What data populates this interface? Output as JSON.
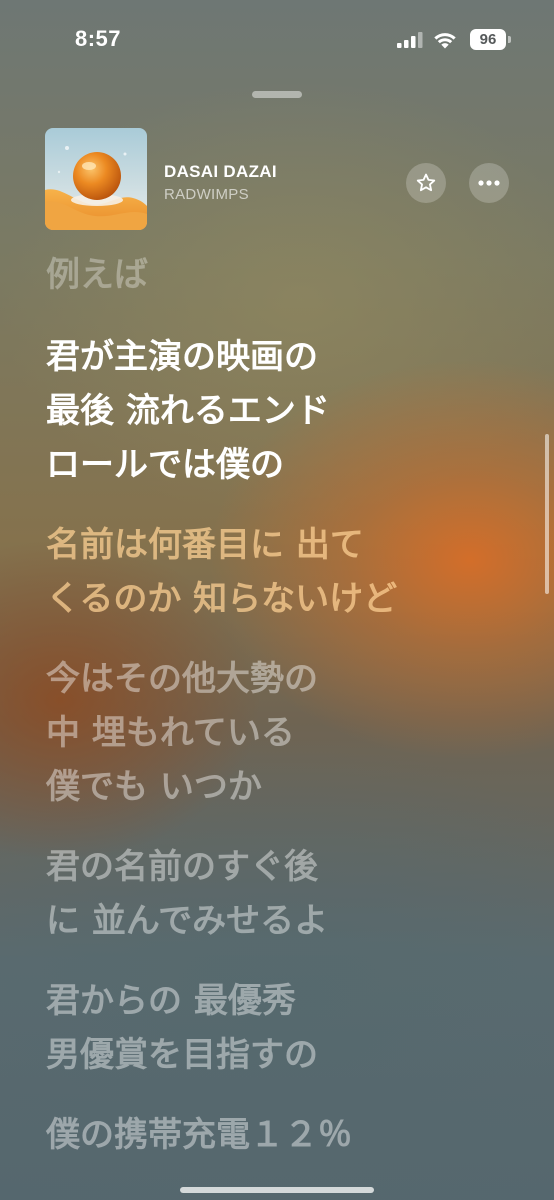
{
  "status_bar": {
    "time": "8:57",
    "battery": "96"
  },
  "now_playing": {
    "title": "DASAI DAZAI",
    "artist": "RADWIMPS"
  },
  "icons": {
    "favorite": "star-icon",
    "more": "ellipsis-icon"
  },
  "lyrics": {
    "past": "例えば",
    "current": [
      "君が主演の映画の",
      "最後 流れるエンド",
      "ロールでは僕の"
    ],
    "upcoming": [
      [
        "名前は何番目に 出て",
        "くるのか 知らないけど"
      ],
      [
        "今はその他大勢の",
        "中 埋もれている",
        "僕でも いつか"
      ],
      [
        "君の名前のすぐ後",
        "に 並んでみせるよ"
      ],
      [
        "君からの 最優秀",
        "男優賞を目指すの"
      ],
      [
        "僕の携帯充電１２％"
      ]
    ]
  },
  "colors": {
    "accent_warm": "#D8782F",
    "text_primary": "#FFFFFF"
  }
}
